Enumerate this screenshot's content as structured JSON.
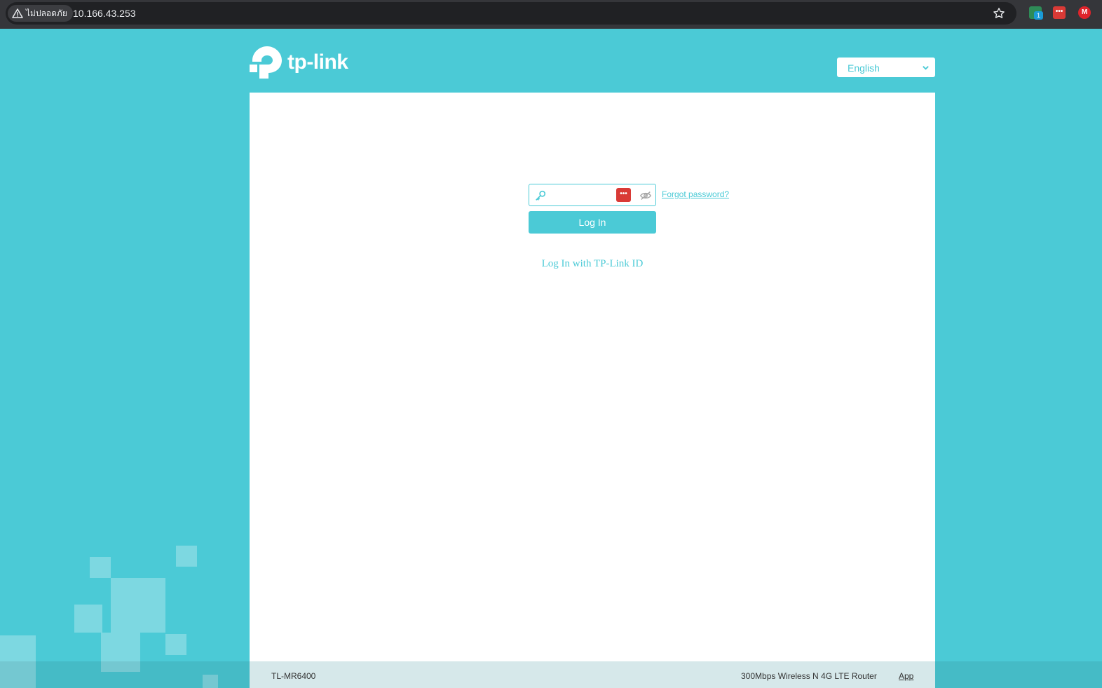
{
  "browser": {
    "security_label": "ไม่ปลอดภัย",
    "url": "10.166.43.253",
    "extension_badge": "1",
    "extension2_glyph": "•••",
    "extension3_glyph": "M"
  },
  "header": {
    "brand": "tp-link",
    "language": {
      "selected": "English"
    }
  },
  "login": {
    "password_placeholder": "",
    "forgot_password": "Forgot password?",
    "login_button": "Log In",
    "tplink_id_link": "Log In with TP-Link ID",
    "autofill_glyph": "•••"
  },
  "footer": {
    "model": "TL-MR6400",
    "description": "300Mbps Wireless N 4G LTE Router",
    "app_link": "App"
  },
  "colors": {
    "brand": "#4bcad6",
    "chrome_bg": "#35363a",
    "autofill_red": "#d93a36"
  }
}
